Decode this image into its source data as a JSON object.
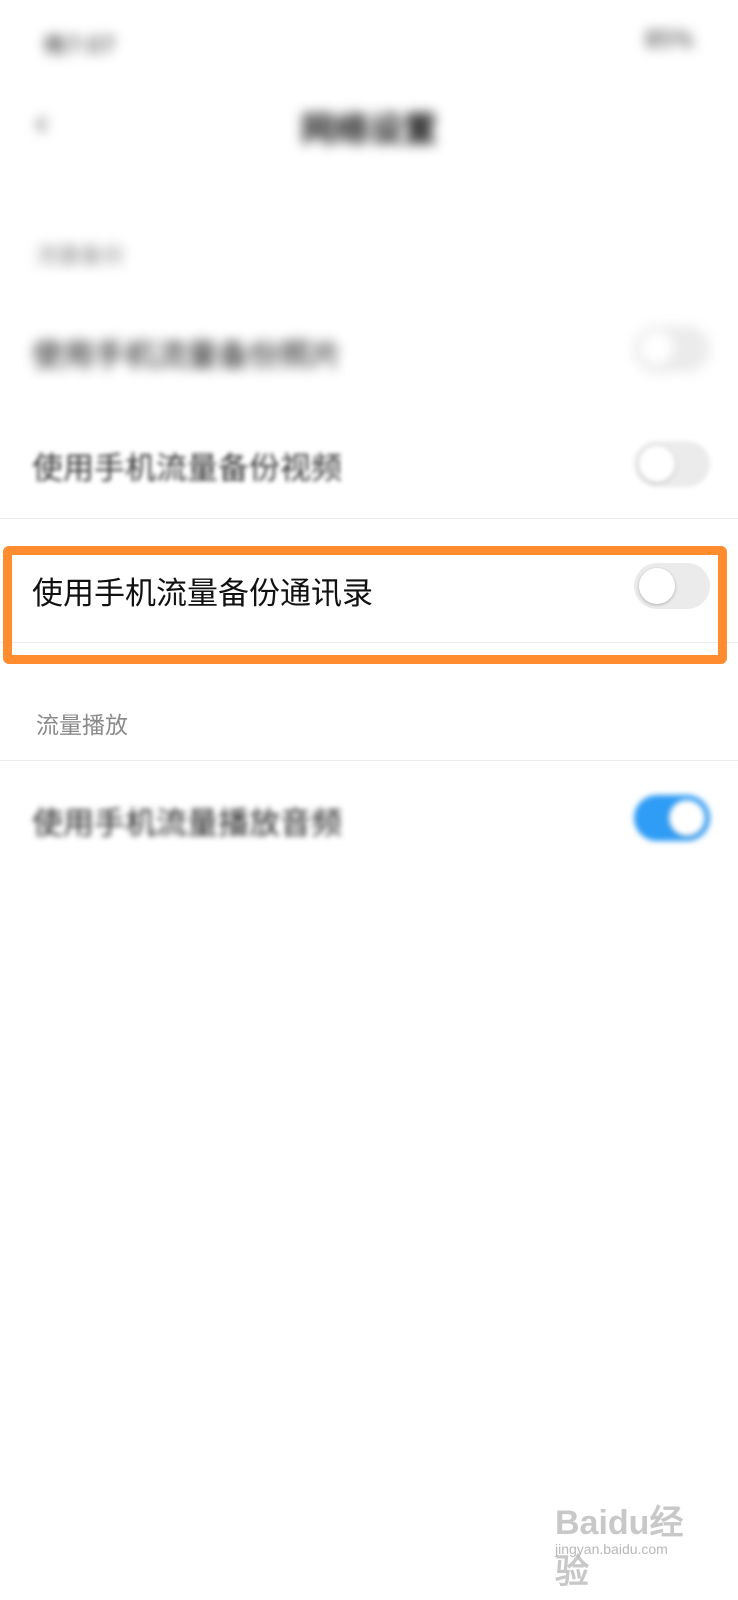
{
  "status_bar": {
    "left": "晚7:07",
    "right": "85%"
  },
  "header": {
    "back_icon": "chevron-left-icon",
    "title": "网络设置"
  },
  "sections": [
    {
      "label": "流量备份",
      "rows": [
        {
          "label": "使用手机流量备份照片",
          "enabled": false
        },
        {
          "label": "使用手机流量备份视频",
          "enabled": false
        },
        {
          "label": "使用手机流量备份通讯录",
          "enabled": false
        }
      ]
    },
    {
      "label": "流量播放",
      "rows": [
        {
          "label": "使用手机流量播放音频",
          "enabled": true
        }
      ]
    }
  ],
  "colors": {
    "highlight": "#ff8c2e",
    "toggle_on": "#2f9cf5",
    "toggle_off": "#ebebeb"
  },
  "watermark": {
    "logo": "Baidu经验",
    "sub": "jingyan.baidu.com"
  }
}
